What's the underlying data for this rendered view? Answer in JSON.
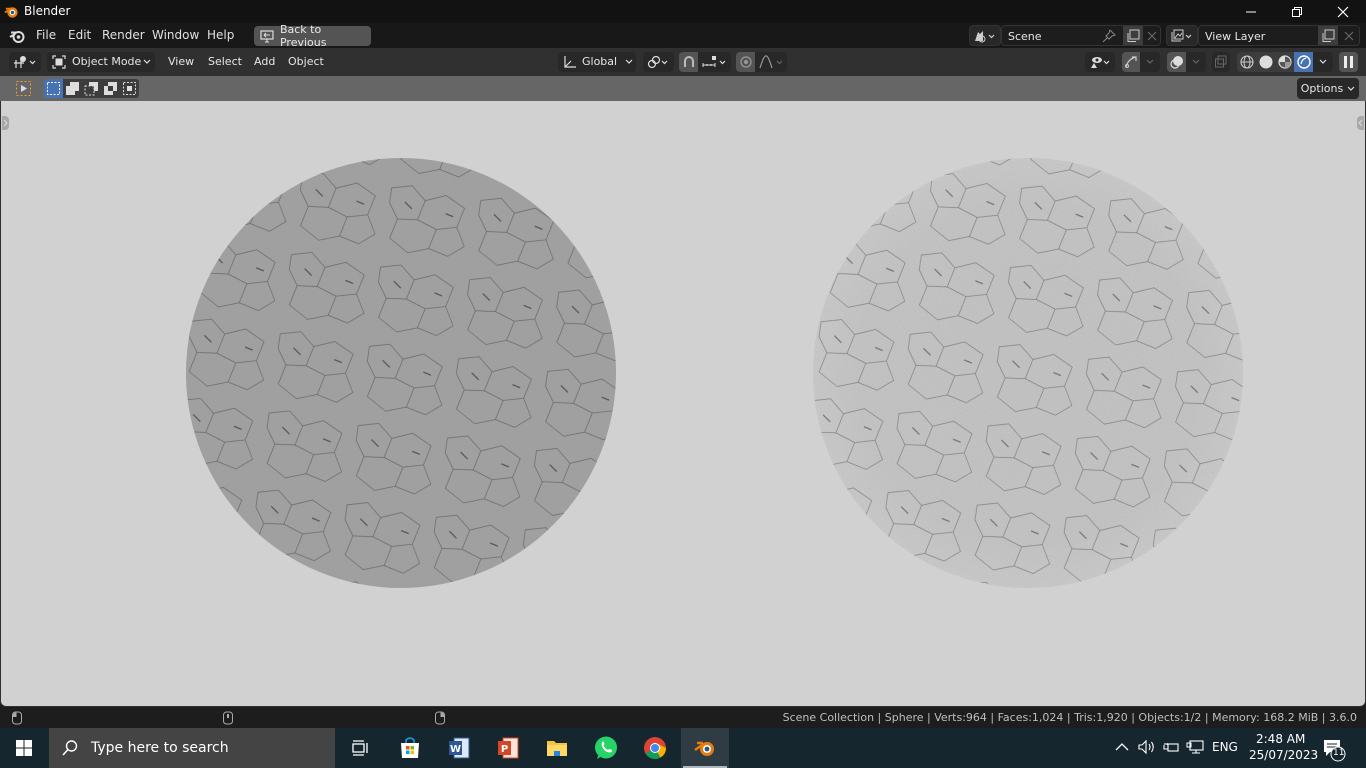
{
  "window": {
    "title": "Blender",
    "controls": {
      "minimize": "—",
      "maximize": "❐",
      "close": "✕"
    }
  },
  "topbar": {
    "menus": [
      "File",
      "Edit",
      "Render",
      "Window",
      "Help"
    ],
    "back_button": "Back to Previous",
    "scene": {
      "label": "Scene"
    },
    "view_layer": {
      "label": "View Layer"
    }
  },
  "header": {
    "mode": "Object Mode",
    "menus": [
      "View",
      "Select",
      "Add",
      "Object"
    ],
    "transform_orientation": "Global",
    "viewport_shading_active": "rendered"
  },
  "tool_settings": {
    "options_label": "Options"
  },
  "viewport": {
    "background_color": "#d1d1d1",
    "objects": [
      {
        "name": "sphere-solid",
        "tone": "#a3a3a3"
      },
      {
        "name": "sphere-faded",
        "tone": "#c9c9c9"
      }
    ]
  },
  "statusbar": {
    "text": "Scene Collection | Sphere | Verts:964 | Faces:1,024 | Tris:1,920 | Objects:1/2 | Memory: 168.2 MiB | 3.6.0"
  },
  "taskbar": {
    "search_placeholder": "Type here to search",
    "apps": [
      "task-view",
      "microsoft-store",
      "word",
      "powerpoint",
      "file-explorer",
      "whatsapp",
      "chrome",
      "blender"
    ],
    "tray": {
      "language": "ENG",
      "time": "2:48 AM",
      "date": "25/07/2023",
      "notification_count": "11"
    }
  },
  "colors": {
    "accent_blue": "#4772b3",
    "blender_orange": "#e87d0d"
  }
}
